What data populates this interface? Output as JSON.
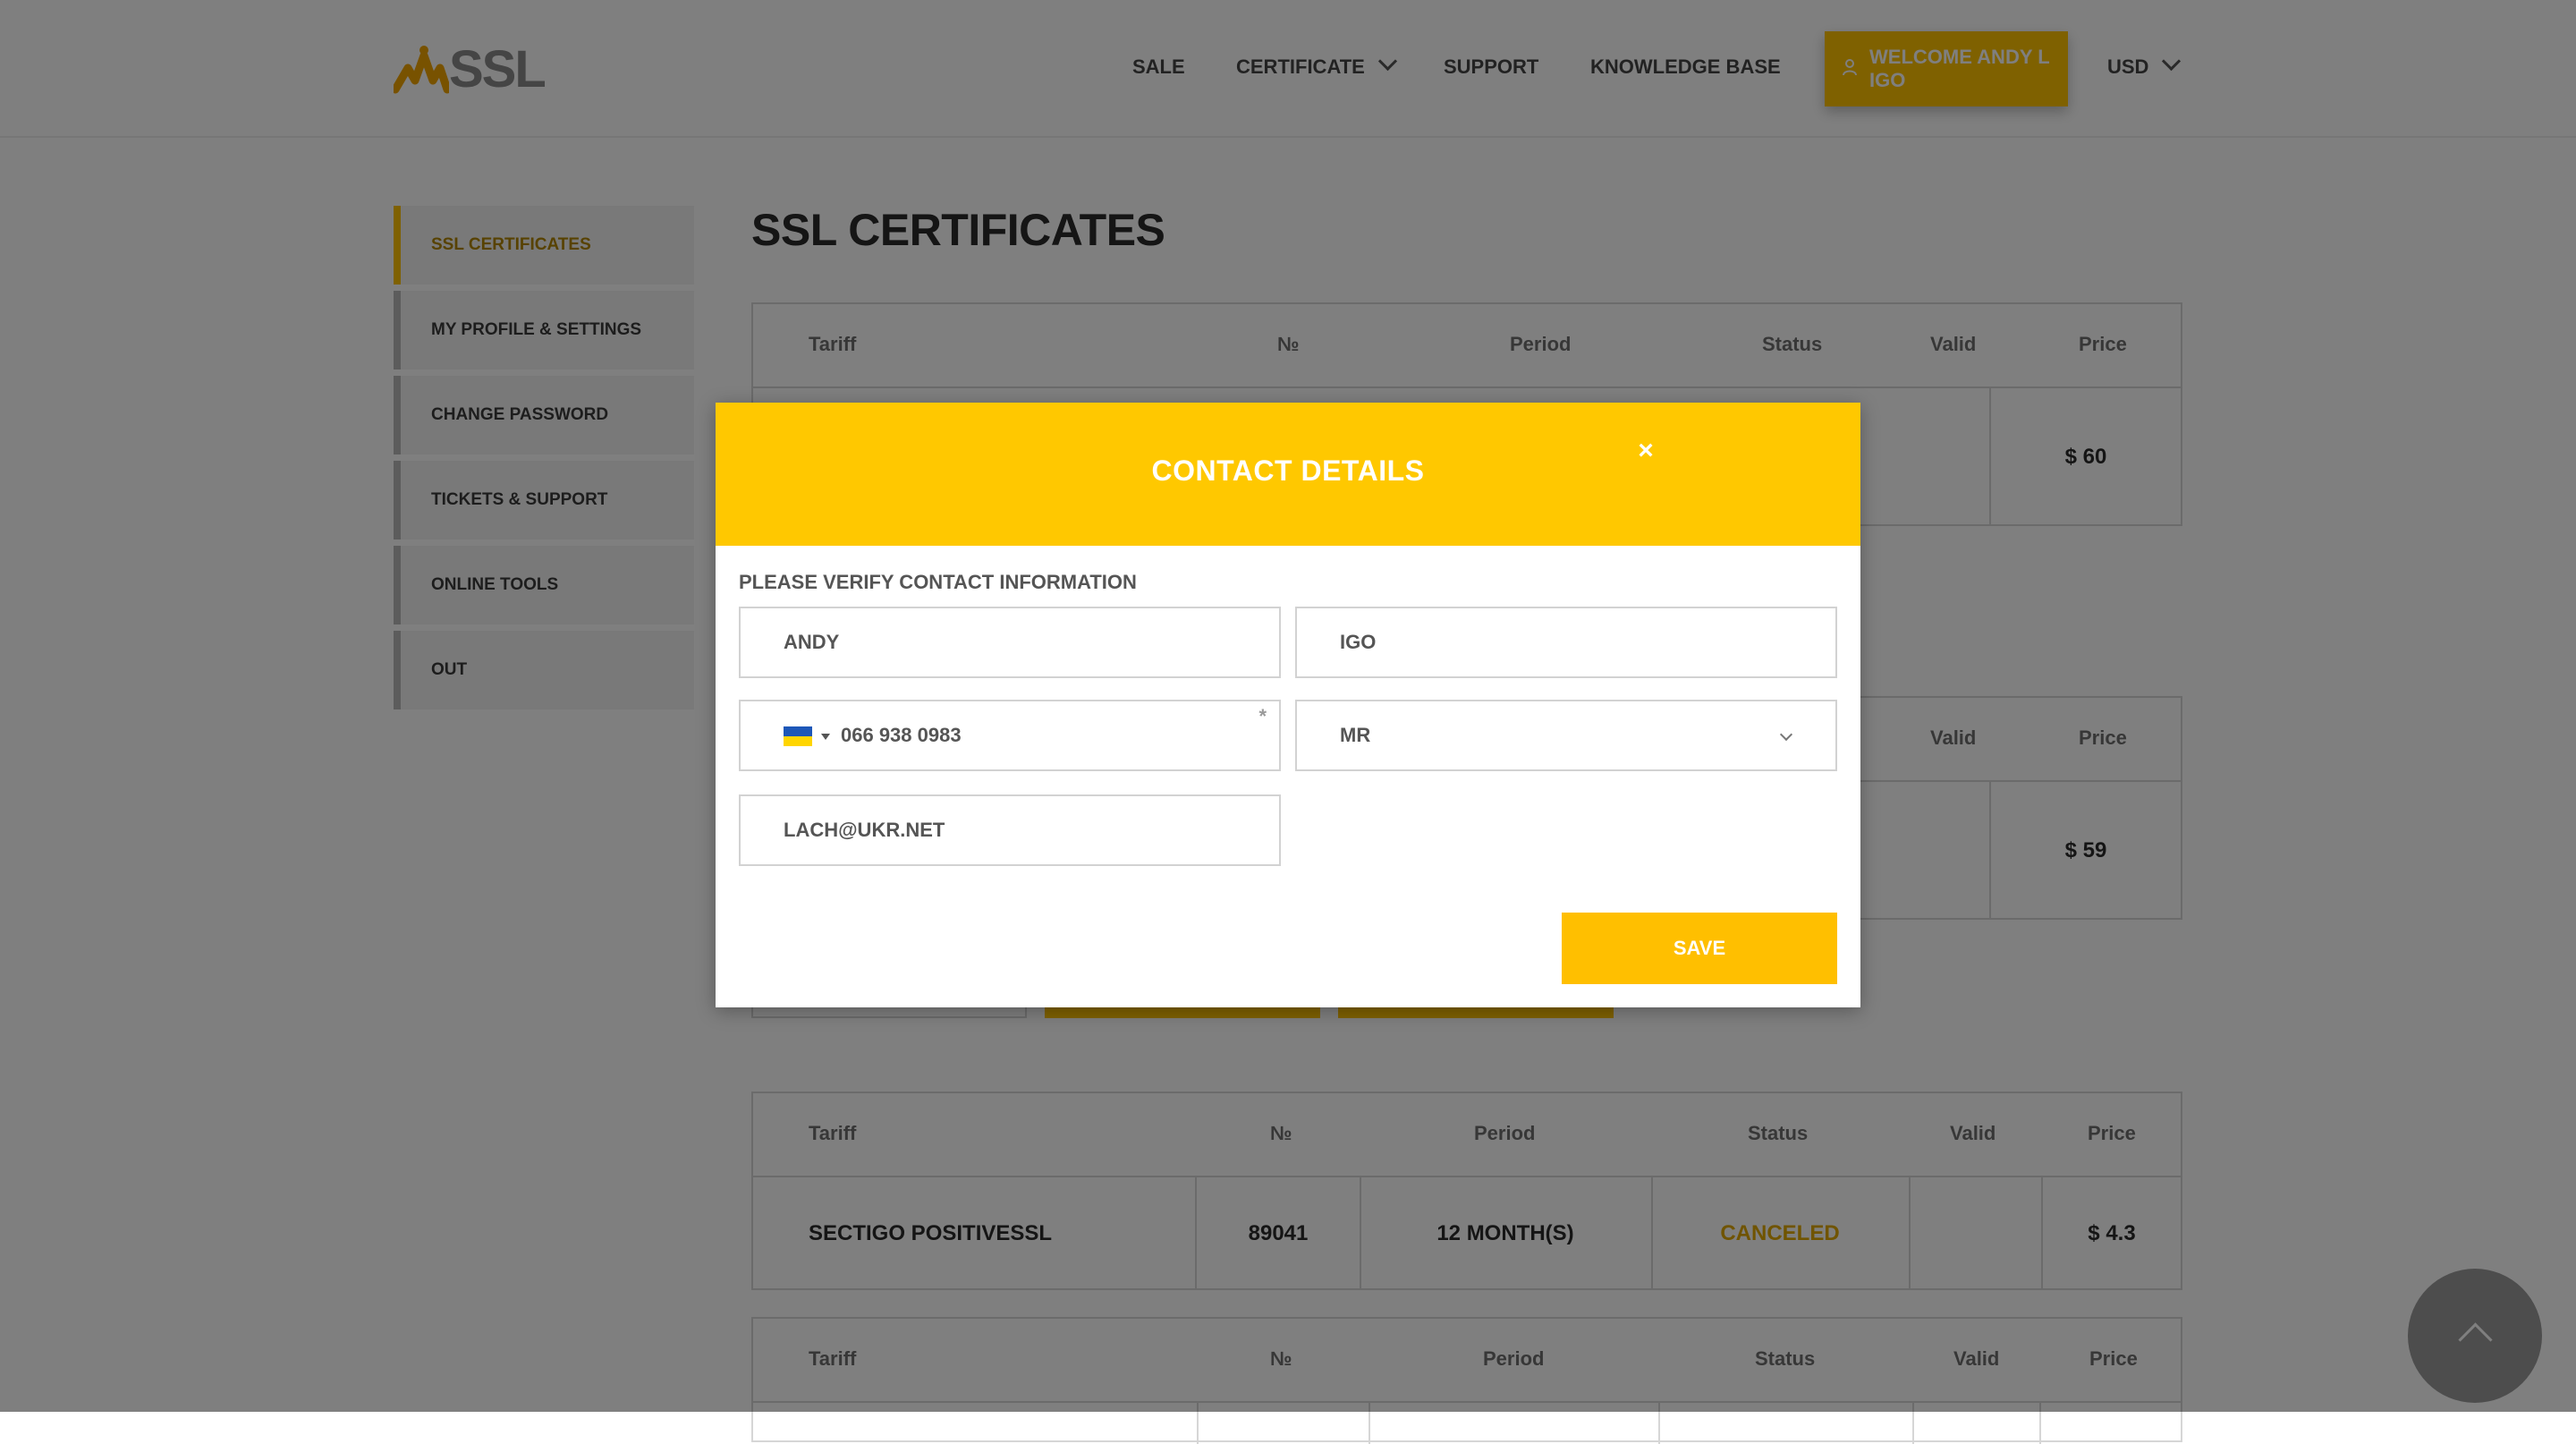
{
  "header": {
    "logo_text": "SSL",
    "nav": {
      "sale": "SALE",
      "certificate": "CERTIFICATE",
      "support": "SUPPORT",
      "knowledge_base": "KNOWLEDGE BASE"
    },
    "welcome_line1": "WELCOME ANDY L",
    "welcome_line2": "IGO",
    "currency": "USD",
    "accent_color": "#ffc200"
  },
  "sidebar": {
    "items": [
      {
        "label": "SSL CERTIFICATES",
        "active": true
      },
      {
        "label": "MY PROFILE & SETTINGS"
      },
      {
        "label": "CHANGE PASSWORD"
      },
      {
        "label": "TICKETS & SUPPORT"
      },
      {
        "label": "ONLINE TOOLS"
      },
      {
        "label": "OUT"
      }
    ]
  },
  "main": {
    "title": "SSL CERTIFICATES",
    "columns": [
      "Tariff",
      "№",
      "Period",
      "Status",
      "Valid",
      "Price"
    ],
    "tables": [
      {
        "price": "$ 60"
      },
      {
        "price": "$ 59"
      },
      {
        "tariff": "SECTIGO POSITIVESSL",
        "number": "89041",
        "period": "12 MONTH(S)",
        "status": "CANCELED",
        "valid": "",
        "price": "$ 4.3"
      },
      {}
    ]
  },
  "modal": {
    "title": "CONTACT DETAILS",
    "close_icon": "×",
    "subtitle": "PLEASE VERIFY CONTACT INFORMATION",
    "first_name": "ANDY",
    "last_name": "IGO",
    "phone": "066 938 0983",
    "phone_required": "*",
    "title_select": "MR",
    "email": "LACH@UKR.NET",
    "save_label": "SAVE"
  }
}
